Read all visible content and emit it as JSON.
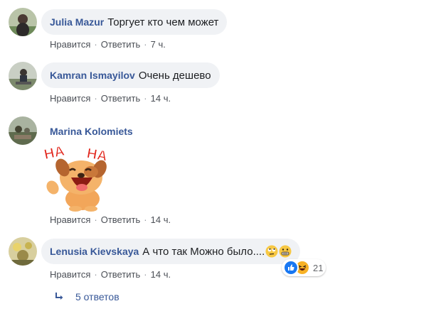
{
  "comments": [
    {
      "author": "Julia Mazur",
      "text": "Торгует кто чем может",
      "actions": {
        "like": "Нравится",
        "reply": "Ответить",
        "time": "7 ч."
      }
    },
    {
      "author": "Kamran Ismayilov",
      "text": "Очень дешево",
      "actions": {
        "like": "Нравится",
        "reply": "Ответить",
        "time": "14 ч."
      }
    },
    {
      "author": "Marina Kolomiets",
      "sticker": "ha-ha-dog-sticker",
      "sticker_text": "HA HA",
      "actions": {
        "like": "Нравится",
        "reply": "Ответить",
        "time": "14 ч."
      }
    },
    {
      "author": "Lenusia Kievskaya",
      "text": "А что так Можно было....",
      "emojis": [
        "rolling-eyes-emoji",
        "grimacing-emoji"
      ],
      "actions": {
        "like": "Нравится",
        "reply": "Ответить",
        "time": "14 ч."
      },
      "reactions": {
        "icons": [
          "like-reaction-icon",
          "haha-reaction-icon"
        ],
        "count": "21"
      }
    }
  ],
  "replies_link": {
    "label": "5 ответов",
    "icon": "reply-arrow-icon"
  },
  "colors": {
    "author": "#385898",
    "bubble": "#f0f2f5",
    "meta": "#4b4f56",
    "like_blue": "#1877f2",
    "haha_yellow": "#f7b125"
  }
}
